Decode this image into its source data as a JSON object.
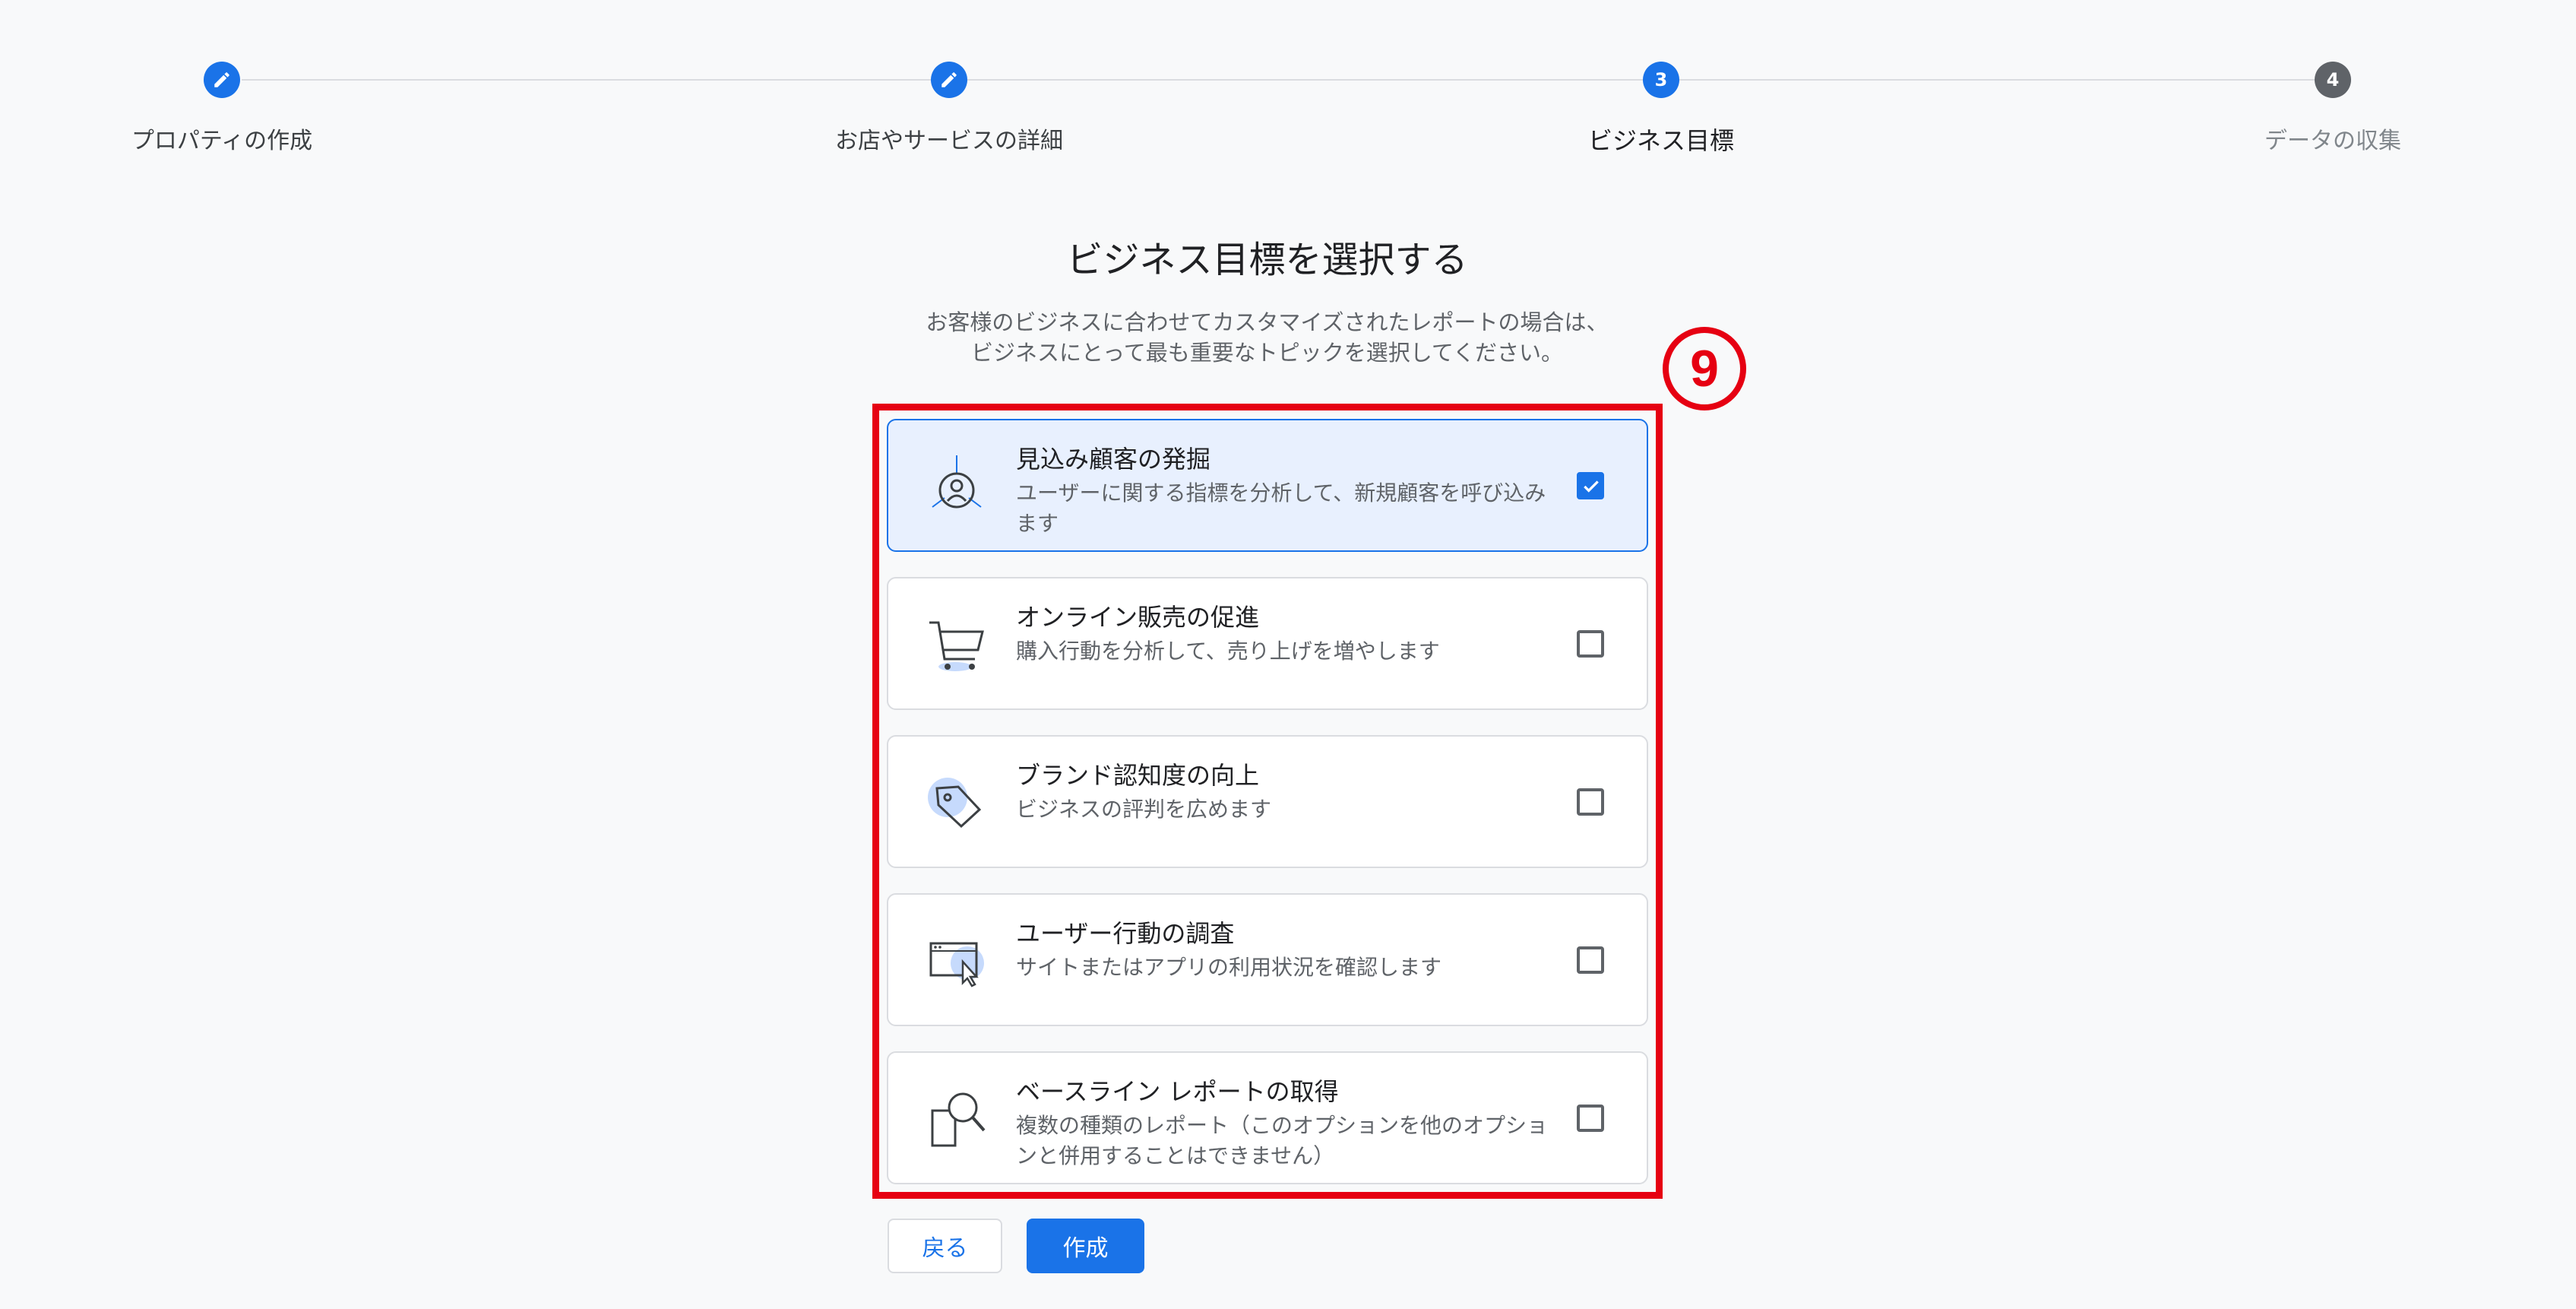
{
  "stepper": {
    "steps": [
      {
        "label": "プロパティの作成",
        "number": "",
        "state": "done"
      },
      {
        "label": "お店やサービスの詳細",
        "number": "",
        "state": "done"
      },
      {
        "label": "ビジネス目標",
        "number": "3",
        "state": "current"
      },
      {
        "label": "データの収集",
        "number": "4",
        "state": "upcoming"
      }
    ]
  },
  "heading": {
    "title": "ビジネス目標を選択する",
    "subtitle_line1": "お客様のビジネスに合わせてカスタマイズされたレポートの場合は、",
    "subtitle_line2": "ビジネスにとって最も重要なトピックを選択してください。"
  },
  "annotation": {
    "number": "9",
    "color": "#e60012"
  },
  "options": [
    {
      "title": "見込み顧客の発掘",
      "desc_line1": "ユーザーに関する指標を分析して、新規顧客を呼び込み",
      "desc_line2": "ます",
      "checked": true,
      "icon": "lead-target-icon"
    },
    {
      "title": "オンライン販売の促進",
      "desc_line1": "購入行動を分析して、売り上げを増やします",
      "desc_line2": "",
      "checked": false,
      "icon": "shopping-cart-icon"
    },
    {
      "title": "ブランド認知度の向上",
      "desc_line1": "ビジネスの評判を広めます",
      "desc_line2": "",
      "checked": false,
      "icon": "price-tag-icon"
    },
    {
      "title": "ユーザー行動の調査",
      "desc_line1": "サイトまたはアプリの利用状況を確認します",
      "desc_line2": "",
      "checked": false,
      "icon": "browser-cursor-icon"
    },
    {
      "title": "ベースライン レポートの取得",
      "desc_line1": "複数の種類のレポート（このオプションを他のオプショ",
      "desc_line2": "ンと併用することはできません）",
      "checked": false,
      "icon": "report-magnifier-icon"
    }
  ],
  "buttons": {
    "back": "戻る",
    "create": "作成"
  },
  "colors": {
    "accent": "#1a73e8",
    "selected_bg": "#e8f0fe",
    "background": "#f8f9fa"
  }
}
